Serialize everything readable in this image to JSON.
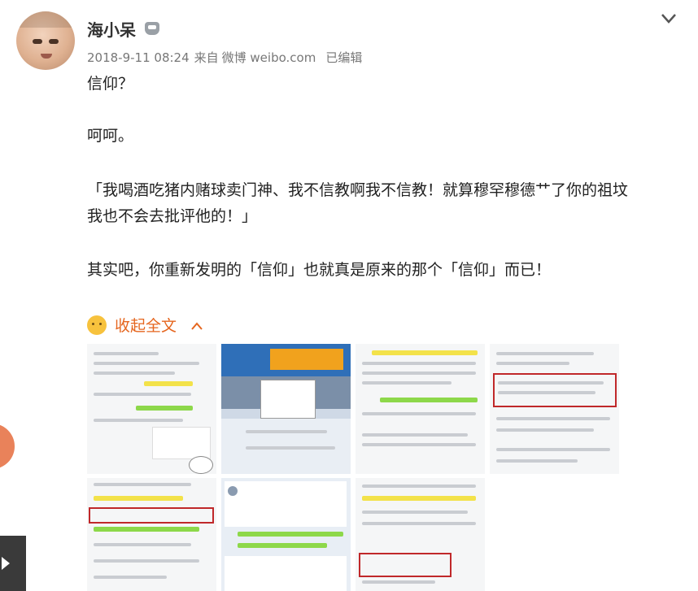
{
  "post": {
    "author": "海小呆",
    "timestamp": "2018-9-11 08:24",
    "source_prefix": "来自",
    "source": "微博 weibo.com",
    "edited": "已编辑",
    "paragraphs": [
      "信仰？",
      "呵呵。",
      "「我喝酒吃猪内赌球卖门神、我不信教啊我不信教！就算穆罕穆德艹了你的祖坟",
      "我也不会去批评他的！」",
      "其实吧，你重新发明的「信仰」也就真是原来的那个「信仰」而已！"
    ],
    "collapse_label": "收起全文",
    "collapse_caret": "^"
  },
  "icons": {
    "menu": "chevron-down-icon",
    "badge": "robot-badge-icon",
    "emoji": "shrug-emoji-icon",
    "play": "play-icon"
  },
  "colors": {
    "accent": "#e5661f",
    "highlight_green": "#8dd84a",
    "highlight_yellow": "#f3e24a",
    "outline_red": "#c0282a"
  }
}
